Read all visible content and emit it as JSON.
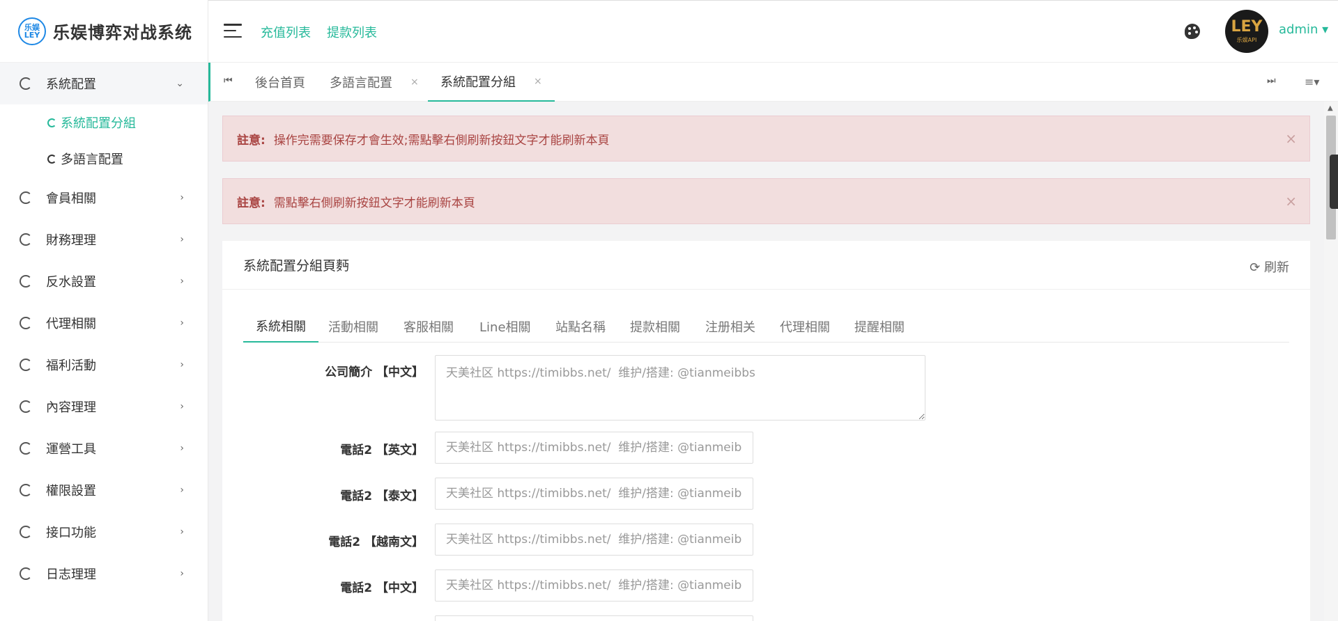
{
  "brand": {
    "badge": "乐娱 LEY",
    "name": "乐娱博弈对战系统"
  },
  "sidebar": {
    "open_group": {
      "label": "系統配置",
      "arrow": "⌄"
    },
    "submenu": [
      {
        "label": "系統配置分組",
        "active": true
      },
      {
        "label": "多語言配置",
        "active": false
      }
    ],
    "items": [
      {
        "label": "會員相關"
      },
      {
        "label": "財務理理"
      },
      {
        "label": "反水設置"
      },
      {
        "label": "代理相關"
      },
      {
        "label": "福利活動"
      },
      {
        "label": "內容理理"
      },
      {
        "label": "運營工具"
      },
      {
        "label": "權限設置"
      },
      {
        "label": "接口功能"
      },
      {
        "label": "日志理理"
      }
    ]
  },
  "header": {
    "links": [
      "充值列表",
      "提款列表"
    ],
    "avatar": {
      "main": "LEY",
      "sub": "乐娱API"
    },
    "user": "admin ▾"
  },
  "tabs": {
    "items": [
      {
        "label": "後台首頁",
        "closable": false
      },
      {
        "label": "多語言配置",
        "closable": true
      },
      {
        "label": "系統配置分組",
        "closable": true,
        "active": true
      }
    ],
    "close_glyph": "×"
  },
  "alerts": [
    {
      "title": "註意:",
      "text": "操作完需要保存才會生效;需點擊右側刷新按鈕文字才能刷新本頁"
    },
    {
      "title": "註意:",
      "text": "需點擊右側刷新按鈕文字才能刷新本頁"
    }
  ],
  "panel": {
    "title": "系統配置分組頁麪",
    "refresh": "⟳ 刷新",
    "subtabs": [
      "系統相關",
      "活動相關",
      "客服相關",
      "Line相關",
      "站點名稱",
      "提款相關",
      "注册相关",
      "代理相關",
      "提醒相關"
    ],
    "active_subtab": 0,
    "fields": [
      {
        "label": "公司簡介 【中文】",
        "type": "textarea",
        "placeholder": "天美社区 https://timibbs.net/  维护/搭建: @tianmeibbs"
      },
      {
        "label": "電話2 【英文】",
        "type": "input",
        "placeholder": "天美社区 https://timibbs.net/  维护/搭建: @tianmeibbs"
      },
      {
        "label": "電話2 【泰文】",
        "type": "input",
        "placeholder": "天美社区 https://timibbs.net/  维护/搭建: @tianmeibbs"
      },
      {
        "label": "電話2 【越南文】",
        "type": "input",
        "placeholder": "天美社区 https://timibbs.net/  维护/搭建: @tianmeibbs"
      },
      {
        "label": "電話2 【中文】",
        "type": "input",
        "placeholder": "天美社区 https://timibbs.net/  维护/搭建: @tianmeibbs"
      }
    ]
  },
  "colors": {
    "accent": "#26b99a",
    "alert_bg": "#f2dede",
    "alert_text": "#a94442"
  },
  "icons": [
    "hamburger-icon",
    "palette-icon",
    "menu-circle-icon",
    "chevron-right-icon",
    "chevron-down-icon",
    "close-icon",
    "refresh-icon",
    "first-page-icon",
    "last-page-icon",
    "tab-menu-icon"
  ]
}
